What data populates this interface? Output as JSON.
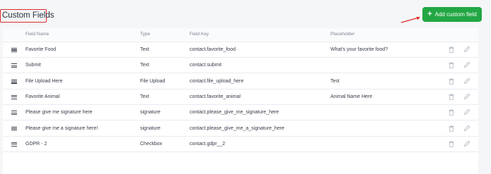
{
  "header": {
    "title": "Custom Fields",
    "add_button_label": "Add custom field",
    "add_button_icon": "plus-icon"
  },
  "colors": {
    "accent_green": "#22a744",
    "highlight_red": "#e02a2a"
  },
  "table": {
    "columns": [
      "Field Name",
      "Type",
      "Field Key",
      "Placeholder"
    ],
    "rows": [
      {
        "name": "Favorite Food",
        "type": "Text",
        "key": "contact.favorite_food",
        "placeholder": "What's your favorite food?"
      },
      {
        "name": "Submit",
        "type": "Text",
        "key": "contact.submit",
        "placeholder": ""
      },
      {
        "name": "File Upload Here",
        "type": "File Upload",
        "key": "contact.file_upload_here",
        "placeholder": "Test"
      },
      {
        "name": "Favorite Animal",
        "type": "Text",
        "key": "contact.favorite_animal",
        "placeholder": "Animal Name Here"
      },
      {
        "name": "Please give me signature here",
        "type": "signature",
        "key": "contact.please_give_me_signature_here",
        "placeholder": ""
      },
      {
        "name": "Please give me a signature here!",
        "type": "signature",
        "key": "contact.please_give_me_a_signature_here",
        "placeholder": ""
      },
      {
        "name": "GDPR - 2",
        "type": "Checkbox",
        "key": "contact.gdpr__2",
        "placeholder": ""
      }
    ]
  }
}
